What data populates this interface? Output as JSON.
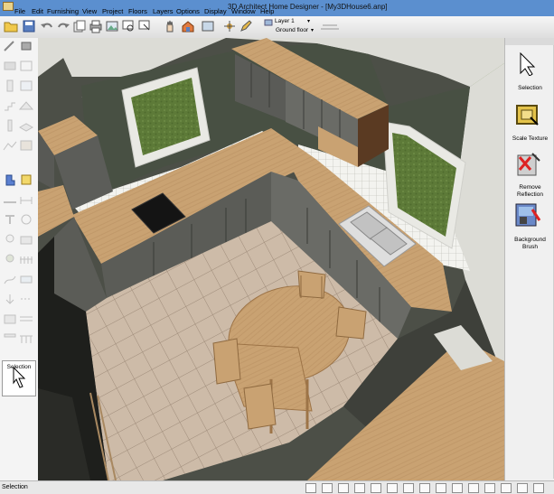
{
  "window": {
    "title": "3D Architect Home Designer - [My3DHouse6.anp]"
  },
  "menu": [
    "File",
    "Edit",
    "Furnishing",
    "View",
    "Project",
    "Floors",
    "Layers",
    "Options",
    "Display",
    "Window",
    "Help"
  ],
  "toolbar": {
    "layer": "Layer 1",
    "floor": "Ground floor"
  },
  "left_panel": {
    "selection_label": "Selection"
  },
  "right_panel": {
    "tools": [
      {
        "label_line1": "Selection",
        "label_line2": "",
        "icon": "arrow-pointer-icon"
      },
      {
        "label_line1": "Scale Texture",
        "label_line2": "",
        "icon": "scale-texture-icon"
      },
      {
        "label_line1": "Remove",
        "label_line2": "Reflection",
        "icon": "remove-reflection-icon"
      },
      {
        "label_line1": "Background",
        "label_line2": "Brush",
        "icon": "background-brush-icon"
      }
    ]
  },
  "status": {
    "text": "Selection"
  },
  "colors": {
    "titlebar": "#5b8fcf",
    "wood": "#c9a272",
    "floor_tile": "#cdbba8",
    "wall": "#4c4f47",
    "grass": "#5d7a38"
  }
}
